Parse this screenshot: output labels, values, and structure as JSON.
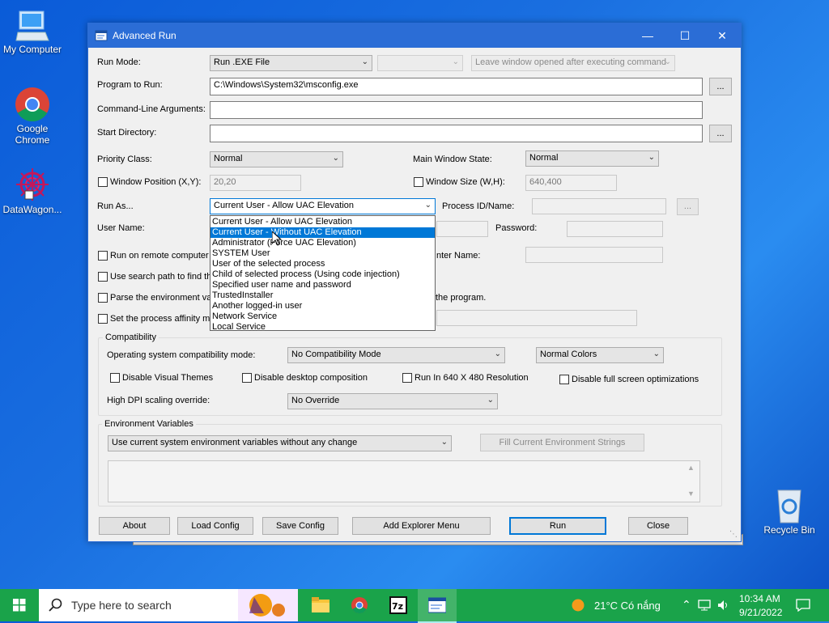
{
  "desktop": {
    "icons": [
      {
        "name": "my-computer",
        "label": "My Computer"
      },
      {
        "name": "google-chrome",
        "label": "Google\nChrome",
        "l1": "Google",
        "l2": "Chrome"
      },
      {
        "name": "datawagon",
        "label": "DataWagon..."
      },
      {
        "name": "recycle-bin",
        "label": "Recycle Bin"
      }
    ]
  },
  "window": {
    "title": "Advanced Run",
    "controls": {
      "minimize": "—",
      "maximize": "☐",
      "close": "✕"
    }
  },
  "form": {
    "run_mode_label": "Run Mode:",
    "run_mode_value": "Run .EXE File",
    "run_mode_secondary": "",
    "leave_window_value": "Leave window opened after executing command",
    "program_label": "Program to Run:",
    "program_value": "C:\\Windows\\System32\\msconfig.exe",
    "browse": "...",
    "cmdline_label": "Command-Line Arguments:",
    "cmdline_value": "",
    "startdir_label": "Start Directory:",
    "startdir_value": "",
    "priority_label": "Priority Class:",
    "priority_value": "Normal",
    "main_window_state_label": "Main Window State:",
    "main_window_state_value": "Normal",
    "window_position_label": "Window Position (X,Y):",
    "window_position_value": "20,20",
    "window_size_label": "Window Size (W,H):",
    "window_size_value": "640,400",
    "run_as_label": "Run As...",
    "run_as_value": "Current User - Allow UAC Elevation",
    "process_label": "Process ID/Name:",
    "process_value": "",
    "user_name_label": "User Name:",
    "password_label": "Password:",
    "remote_label": "Run on remote computer",
    "computer_name_label": "nter Name:",
    "search_path_label": "Use search path to find th",
    "parse_env_label": "Parse the environment va",
    "parse_env_suffix": "the program.",
    "affinity_label": "Set the process affinity m"
  },
  "run_as_options": [
    "Current User - Allow UAC Elevation",
    "Current User - Without UAC Elevation",
    "Administrator (Force UAC Elevation)",
    "SYSTEM User",
    "User of the selected process",
    "Child of selected process (Using code injection)",
    "Specified user name and password",
    "TrustedInstaller",
    "Another logged-in user",
    "Network Service",
    "Local Service"
  ],
  "run_as_selected_index": 1,
  "compatibility": {
    "group_title": "Compatibility",
    "os_mode_label": "Operating system compatibility mode:",
    "os_mode_value": "No Compatibility Mode",
    "colors_value": "Normal Colors",
    "disable_visual_themes": "Disable Visual Themes",
    "disable_desktop_composition": "Disable desktop composition",
    "run_640": "Run In 640 X 480 Resolution",
    "disable_fullscreen_opt": "Disable full screen optimizations",
    "dpi_label": "High DPI scaling override:",
    "dpi_value": "No Override"
  },
  "environment": {
    "group_title": "Environment Variables",
    "mode_value": "Use current system environment variables without any change",
    "fill_button": "Fill Current Environment Strings",
    "text_value": ""
  },
  "buttons": {
    "about": "About",
    "load_config": "Load Config",
    "save_config": "Save Config",
    "add_explorer_menu": "Add Explorer Menu",
    "run": "Run",
    "close": "Close"
  },
  "taskbar": {
    "search_placeholder": "Type here to search",
    "weather": "21°C  Có nắng",
    "time": "10:34 AM",
    "date": "9/21/2022"
  },
  "colors": {
    "accent": "#0078d7",
    "titlebar": "#2b6dd6",
    "taskbar": "#1aa34a"
  }
}
